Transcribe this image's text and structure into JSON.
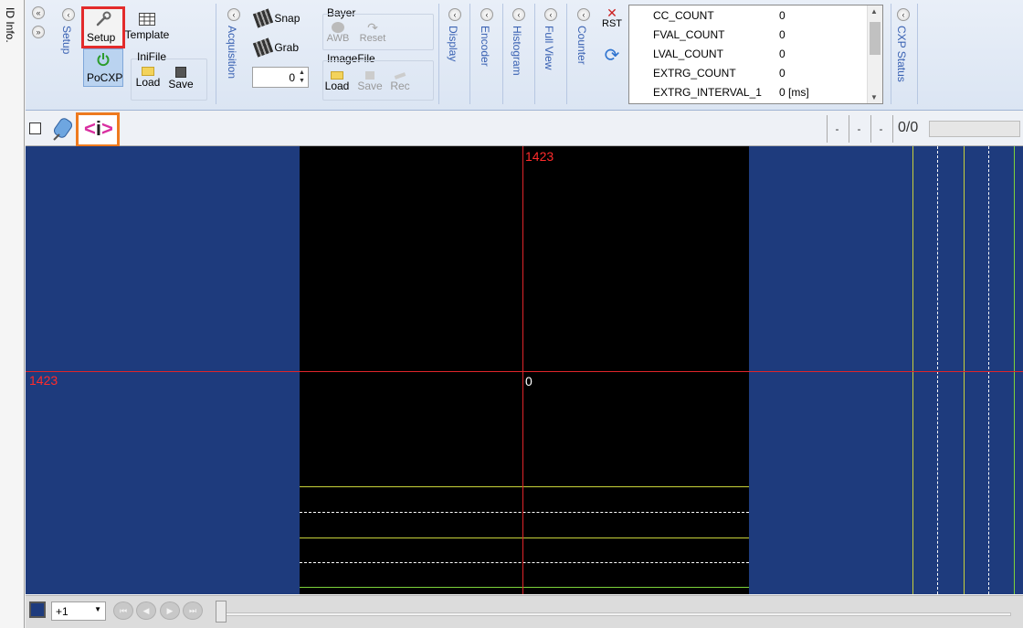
{
  "side_tab": {
    "label": "ID Info."
  },
  "ribbon": {
    "collapse_left": "«",
    "expand_right": "»",
    "setup": {
      "group_label": "Setup",
      "setup_btn": "Setup",
      "template_btn": "Template",
      "pocxp_btn": "PoCXP",
      "inifile_title": "IniFile",
      "load_btn": "Load",
      "save_btn": "Save"
    },
    "acquisition": {
      "group_label": "Acquisition",
      "snap_btn": "Snap",
      "grab_btn": "Grab",
      "frame_count": "0"
    },
    "bayer": {
      "title": "Bayer",
      "awb_btn": "AWB",
      "reset_btn": "Reset"
    },
    "imagefile": {
      "title": "ImageFile",
      "load_btn": "Load",
      "save_btn": "Save",
      "rec_btn": "Rec"
    },
    "display": {
      "group_label": "Display"
    },
    "encoder": {
      "group_label": "Encoder"
    },
    "histogram": {
      "group_label": "Histogram"
    },
    "fullview": {
      "group_label": "Full View"
    },
    "counter": {
      "group_label": "Counter",
      "rst_btn": "RST",
      "rows": [
        {
          "name": "CC_COUNT",
          "value": "0"
        },
        {
          "name": "FVAL_COUNT",
          "value": "0"
        },
        {
          "name": "LVAL_COUNT",
          "value": "0"
        },
        {
          "name": "EXTRG_COUNT",
          "value": "0"
        },
        {
          "name": "EXTRG_INTERVAL_1",
          "value": "0 [ms]"
        }
      ]
    },
    "cxp_status": {
      "group_label": "CXP Status"
    }
  },
  "viewer_toolbar": {
    "dash_1": "-",
    "dash_2": "-",
    "dash_3": "-",
    "frame_indicator": "0/0"
  },
  "image_view": {
    "top_coordinate": "1423",
    "left_coordinate": "1423",
    "center_value": "0"
  },
  "bottom_bar": {
    "zoom_value": "+1"
  },
  "colors": {
    "background_blue": "#1e3b7d",
    "crosshair_red": "#e0252a",
    "highlight_red": "#e32b2b",
    "highlight_orange": "#ee7a1e"
  }
}
